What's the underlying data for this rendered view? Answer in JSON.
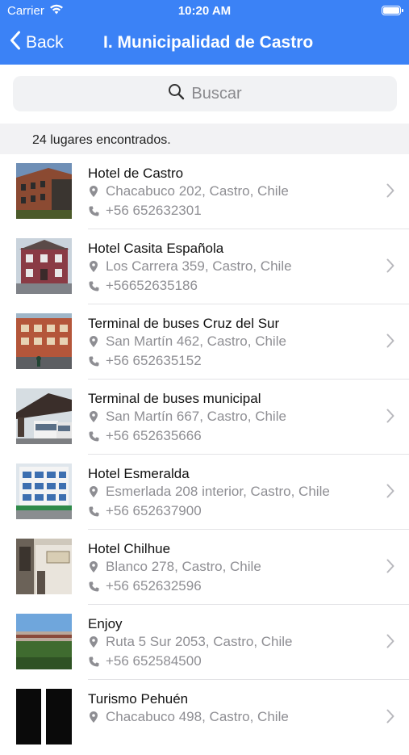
{
  "status": {
    "carrier": "Carrier",
    "time": "10:20 AM"
  },
  "nav": {
    "back_label": "Back",
    "title": "I. Municipalidad de Castro"
  },
  "search": {
    "placeholder": "Buscar"
  },
  "results": {
    "count_text": "24 lugares encontrados.",
    "items": [
      {
        "name": "Hotel de Castro",
        "address": "Chacabuco 202, Castro, Chile",
        "phone": "+56 652632301"
      },
      {
        "name": "Hotel Casita Española",
        "address": "Los Carrera 359, Castro, Chile",
        "phone": "+56652635186"
      },
      {
        "name": "Terminal de buses Cruz del Sur",
        "address": "San Martín 462, Castro, Chile",
        "phone": "+56 652635152"
      },
      {
        "name": "Terminal de buses municipal",
        "address": "San Martín 667, Castro, Chile",
        "phone": "+56 652635666"
      },
      {
        "name": "Hotel Esmeralda",
        "address": "Esmerlada 208 interior, Castro, Chile",
        "phone": "+56 652637900"
      },
      {
        "name": "Hotel Chilhue",
        "address": "Blanco 278, Castro, Chile",
        "phone": "+56 652632596"
      },
      {
        "name": "Enjoy",
        "address": "Ruta 5 Sur 2053, Castro, Chile",
        "phone": "+56 652584500"
      },
      {
        "name": "Turismo Pehuén",
        "address": "Chacabuco 498, Castro, Chile",
        "phone": ""
      }
    ]
  },
  "colors": {
    "nav_bar": "#3b82f6",
    "secondary_text": "#8e8e93"
  },
  "icons": [
    "wifi-icon",
    "battery-icon",
    "chevron-left-icon",
    "search-icon",
    "location-pin-icon",
    "phone-icon",
    "chevron-right-icon"
  ]
}
